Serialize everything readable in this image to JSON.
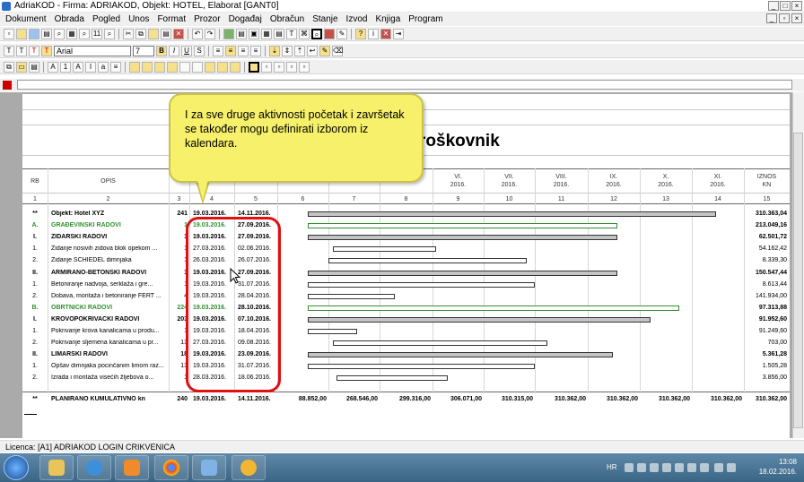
{
  "window": {
    "title": "AdriaKOD - Firma: ADRIAKOD,  Objekt: HOTEL, Elaborat [GANT0]"
  },
  "menu": [
    "Dokument",
    "Obrada",
    "Pogled",
    "Unos",
    "Format",
    "Prozor",
    "Događaj",
    "Obračun",
    "Stanje",
    "Izvod",
    "Knjiga",
    "Program"
  ],
  "toolbar": {
    "font_name": "Arial",
    "font_size": "7",
    "font_size_icon": "11"
  },
  "colors": {
    "accent_red": "#cc0000",
    "callout_yellow": "#f6f06a",
    "highlight_red": "#e01010",
    "green_text": "#2f8f2f"
  },
  "document": {
    "title_partial": "roškovnik",
    "header": {
      "rb": "RB",
      "opis": "OPIS",
      "iznos": "IZNOS",
      "kn": "KN",
      "months": [
        {
          "roman": "VI.",
          "year": "2016."
        },
        {
          "roman": "VII.",
          "year": "2016."
        },
        {
          "roman": "VIII.",
          "year": "2016."
        },
        {
          "roman": "IX.",
          "year": "2016."
        },
        {
          "roman": "X.",
          "year": "2016."
        },
        {
          "roman": "XI.",
          "year": "2016."
        }
      ],
      "col_numbers": [
        "1",
        "2",
        "3",
        "4",
        "5",
        "6",
        "7",
        "8",
        "9",
        "10",
        "11",
        "12",
        "13",
        "14",
        "15"
      ]
    },
    "rows": [
      {
        "rb": "**",
        "opis": "Objekt: Hotel XYZ",
        "n": "241",
        "d1": "19.03.2016.",
        "d2": "14.11.2016.",
        "iznos": "310.363,04",
        "style": "bold"
      },
      {
        "rb": "A.",
        "opis": "GRAĐEVINSKI RADOVI",
        "n": "1",
        "d1": "19.03.2016.",
        "d2": "27.09.2016.",
        "iznos": "213.049,16",
        "style": "green"
      },
      {
        "rb": "I.",
        "opis": "ZIDARSKI RADOVI",
        "n": "1",
        "d1": "19.03.2016.",
        "d2": "27.09.2016.",
        "iznos": "62.501,72",
        "style": "bold"
      },
      {
        "rb": "1.",
        "opis": "Zidanje nosivih zidova blok opekom ...",
        "n": "1",
        "d1": "27.03.2016.",
        "d2": "02.06.2016.",
        "iznos": "54.162,42",
        "style": ""
      },
      {
        "rb": "2.",
        "opis": "Zidanje SCHIEDEL dimnjaka",
        "n": "1",
        "d1": "26.03.2016.",
        "d2": "26.07.2016.",
        "iznos": "8.339,30",
        "style": ""
      },
      {
        "rb": "II.",
        "opis": "ARMIRANO-BETONSKI RADOVI",
        "n": "1",
        "d1": "19.03.2016.",
        "d2": "27.09.2016.",
        "iznos": "150.547,44",
        "style": "bold"
      },
      {
        "rb": "1.",
        "opis": "Betoniranje nadvoja, serklaža i gre...",
        "n": "1",
        "d1": "19.03.2016.",
        "d2": "31.07.2016.",
        "iznos": "8.613,44",
        "style": ""
      },
      {
        "rb": "2.",
        "opis": "Dobava, montaža i betoniranje FERT ...",
        "n": "4",
        "d1": "19.03.2016.",
        "d2": "28.04.2016.",
        "iznos": "141.934,00",
        "style": ""
      },
      {
        "rb": "B.",
        "opis": "OBRTNIČKI RADOVI",
        "n": "224",
        "d1": "19.03.2016.",
        "d2": "28.10.2016.",
        "iznos": "97.313,88",
        "style": "green"
      },
      {
        "rb": "I.",
        "opis": "KROVOPOKRIVAČKI RADOVI",
        "n": "203",
        "d1": "19.03.2016.",
        "d2": "07.10.2016.",
        "iznos": "91.952,60",
        "style": "bold"
      },
      {
        "rb": "1.",
        "opis": "Pokrivanje krova kanalicama u produ...",
        "n": "1",
        "d1": "19.03.2016.",
        "d2": "18.04.2016.",
        "iznos": "91.249,60",
        "style": ""
      },
      {
        "rb": "2.",
        "opis": "Pokrivanje sljemena kanalicama u pr...",
        "n": "13",
        "d1": "27.03.2016.",
        "d2": "09.08.2016.",
        "iznos": "703,00",
        "style": ""
      },
      {
        "rb": "II.",
        "opis": "LIMARSKI RADOVI",
        "n": "18",
        "d1": "19.03.2016.",
        "d2": "23.09.2016.",
        "iznos": "5.361,28",
        "style": "bold"
      },
      {
        "rb": "1.",
        "opis": "Opšav dimnjaka pocinčanim limom raz...",
        "n": "13",
        "d1": "19.03.2016.",
        "d2": "31.07.2016.",
        "iznos": "1.505,28",
        "style": ""
      },
      {
        "rb": "2.",
        "opis": "Izrada i montaža visećih žljebova o...",
        "n": "1",
        "d1": "28.03.2016.",
        "d2": "18.06.2016.",
        "iznos": "3.856,00",
        "style": ""
      }
    ],
    "bars": [
      {
        "start": 0.0,
        "end": 0.99,
        "fill": "grey"
      },
      {
        "start": 0.0,
        "end": 0.75,
        "fill": "white-green"
      },
      {
        "start": 0.0,
        "end": 0.75,
        "fill": "grey"
      },
      {
        "start": 0.06,
        "end": 0.31,
        "fill": "white"
      },
      {
        "start": 0.05,
        "end": 0.53,
        "fill": "white"
      },
      {
        "start": 0.0,
        "end": 0.75,
        "fill": "grey"
      },
      {
        "start": 0.0,
        "end": 0.55,
        "fill": "white"
      },
      {
        "start": 0.0,
        "end": 0.21,
        "fill": "white"
      },
      {
        "start": 0.0,
        "end": 0.9,
        "fill": "white-green"
      },
      {
        "start": 0.0,
        "end": 0.83,
        "fill": "grey"
      },
      {
        "start": 0.0,
        "end": 0.12,
        "fill": "white"
      },
      {
        "start": 0.06,
        "end": 0.58,
        "fill": "white"
      },
      {
        "start": 0.0,
        "end": 0.74,
        "fill": "grey"
      },
      {
        "start": 0.0,
        "end": 0.55,
        "fill": "white"
      },
      {
        "start": 0.07,
        "end": 0.34,
        "fill": "white"
      }
    ],
    "total": {
      "rb": "**",
      "opis": "PLANIRANO KUMULATIVNO kn",
      "n": "240",
      "d1": "19.03.2016.",
      "d2": "14.11.2016.",
      "months": [
        "88.852,00",
        "268.546,00",
        "299.316,00",
        "306.071,00",
        "310.315,00",
        "310.362,00",
        "310.362,00",
        "310.362,00",
        "310.362,00"
      ],
      "iznos": "310.362,00"
    }
  },
  "callout": {
    "text": "I za sve druge aktivnosti početak i završetak se također mogu definirati izborom iz kalendara."
  },
  "status": {
    "licence": "Licenca: [A1] ADRIAKOD LOGIN CRIKVENICA"
  },
  "taskbar": {
    "lang": "HR",
    "time": "13:08",
    "date": "18.02.2016."
  }
}
